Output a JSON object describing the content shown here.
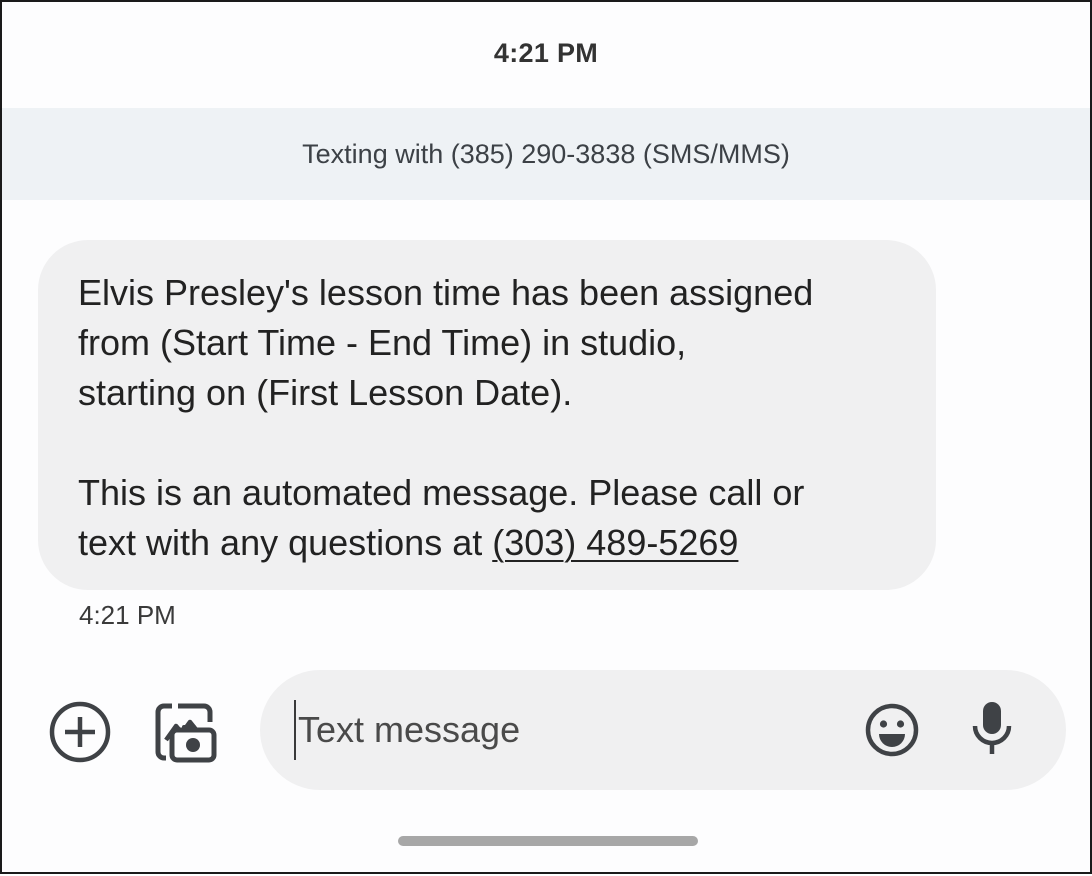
{
  "status_time": "4:21 PM",
  "banner": {
    "text": "Texting with (385) 290-3838 (SMS/MMS)"
  },
  "message": {
    "paragraph1": "Elvis Presley's lesson time has been assigned\nfrom (Start Time - End Time) in studio,\nstarting on (First Lesson Date).",
    "paragraph2_prefix": "This is an automated message. Please call or\ntext with any questions at ",
    "phone_link": "(303) 489-5269",
    "timestamp": "4:21 PM"
  },
  "compose": {
    "placeholder": "Text message",
    "value": ""
  },
  "icons": {
    "add": "add-circle-icon",
    "gallery": "gallery-camera-icon",
    "emoji": "emoji-icon",
    "mic": "microphone-icon"
  },
  "colors": {
    "bubble": "#f0f0f1",
    "banner": "#eef2f5",
    "text": "#222222",
    "home_indicator": "#a7a7a7"
  }
}
